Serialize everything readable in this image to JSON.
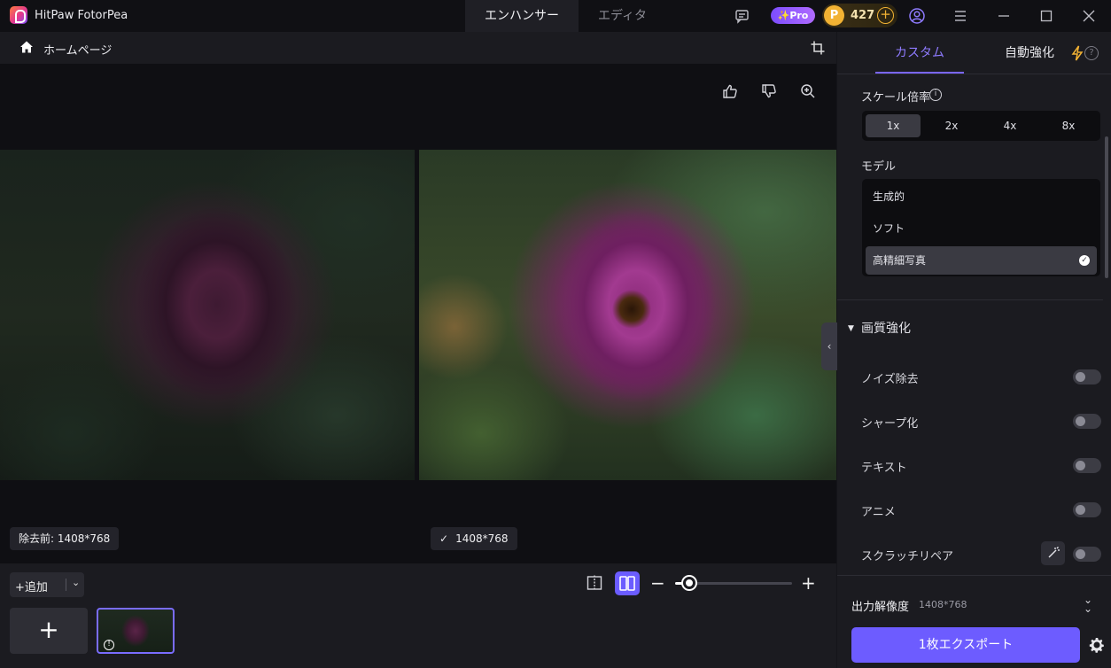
{
  "app": {
    "name": "HitPaw FotorPea",
    "mode_tabs": [
      {
        "label": "エンハンサー",
        "active": true
      },
      {
        "label": "エディタ",
        "active": false
      }
    ],
    "pro_label": "✨Pro",
    "coins": "427"
  },
  "breadcrumb": {
    "home_label": "ホームページ"
  },
  "images": {
    "before_label": "除去前: 1408*768",
    "after_label": "1408*768"
  },
  "bottom": {
    "add_label": "+追加",
    "zoom_level": 0.12
  },
  "panel": {
    "tabs": {
      "custom": "カスタム",
      "auto": "自動強化"
    },
    "scale_label": "スケール倍率",
    "scale_options": [
      "1x",
      "2x",
      "4x",
      "8x"
    ],
    "scale_selected": "1x",
    "model_label": "モデル",
    "models": [
      "生成的",
      "ソフト",
      "高精細写真"
    ],
    "model_selected": "高精細写真",
    "quality_section": "画質強化",
    "toggles": [
      {
        "label": "ノイズ除去",
        "on": false
      },
      {
        "label": "シャープ化",
        "on": false
      },
      {
        "label": "テキスト",
        "on": false
      },
      {
        "label": "アニメ",
        "on": false
      },
      {
        "label": "スクラッチリペア",
        "on": false
      }
    ],
    "output_label": "出力解像度",
    "output_resolution": "1408*768",
    "export_label": "1枚エクスポート"
  },
  "colors": {
    "accent": "#6d5cff",
    "coin": "#f2b233"
  }
}
